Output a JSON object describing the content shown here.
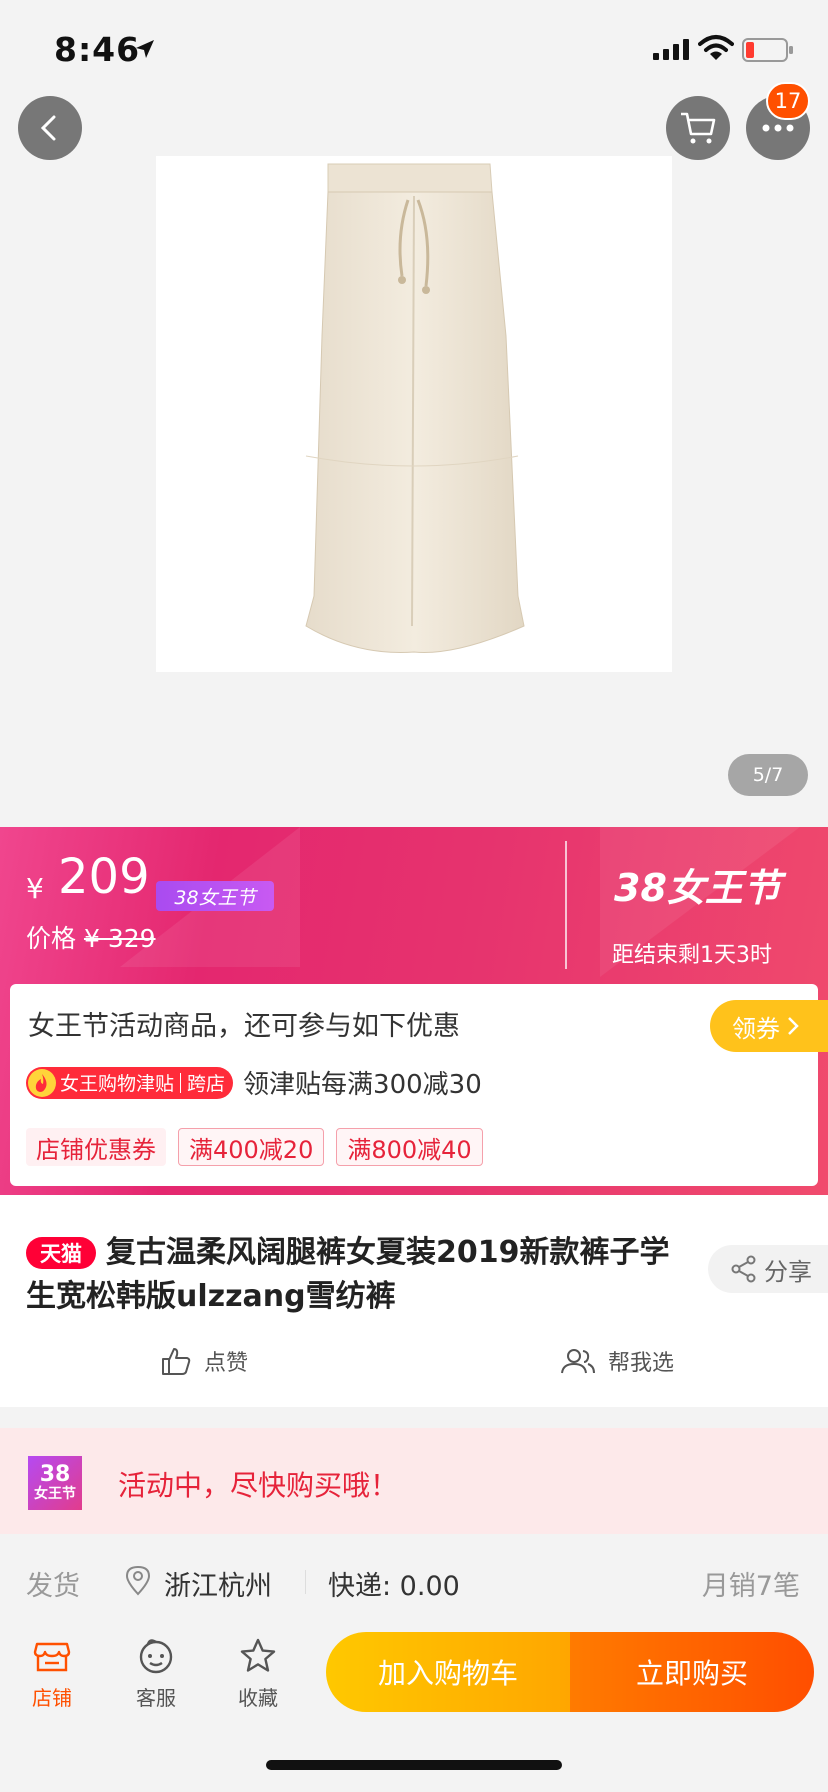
{
  "status_bar": {
    "time": "8:46"
  },
  "gallery": {
    "cart_badge": "17",
    "pager": "5/7"
  },
  "promo": {
    "currency": "¥",
    "price": "209",
    "festival_tag": "38女王节",
    "original_price_label": "价格",
    "original_price": "¥ 329",
    "festival_logo": "38女王节",
    "countdown": "距结束剩1天3时"
  },
  "coupons": {
    "title": "女王节活动商品，还可参与如下优惠",
    "claim_label": "领券",
    "allowance_tag": "女王购物津贴",
    "allowance_tag_scope": "跨店",
    "allowance_text": "领津贴每满300减30",
    "chips": [
      "店铺优惠券",
      "满400减20",
      "满800减40"
    ]
  },
  "product": {
    "platform_tag": "天猫",
    "title": "复古温柔风阔腿裤女夏装2019新款裤子学生宽松韩版ulzzang雪纺裤",
    "share_label": "分享",
    "like_label": "点赞",
    "help_label": "帮我选"
  },
  "activity": {
    "icon_number": "38",
    "icon_label": "女王节",
    "text": "活动中，尽快购买哦！"
  },
  "shipping": {
    "label": "发货",
    "location": "浙江杭州",
    "fee": "快递: 0.00",
    "sales": "月销7笔"
  },
  "bottom_bar": {
    "store_label": "店铺",
    "service_label": "客服",
    "favorite_label": "收藏",
    "add_to_cart": "加入购物车",
    "buy_now": "立即购买"
  },
  "colors": {
    "tmall_red": "#ff0036",
    "accent_orange": "#ff5000",
    "claim_yellow": "#ffc21b",
    "banner_pink": "#e4276f"
  }
}
